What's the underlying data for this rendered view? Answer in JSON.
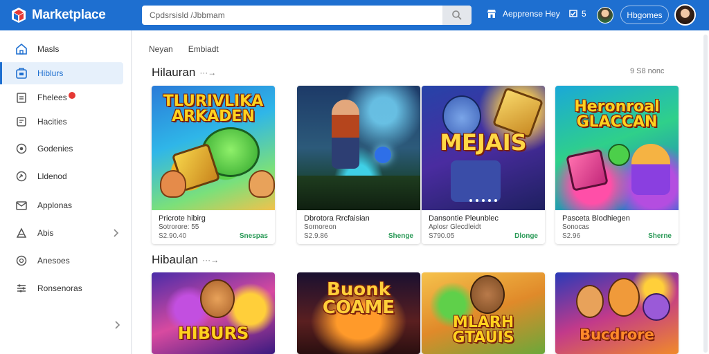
{
  "app": {
    "name": "Marketplace"
  },
  "search": {
    "placeholder": "Cpdsrsisld /Jbbmam"
  },
  "topbar": {
    "store_label": "Aepprense Hey",
    "cart_count": "5",
    "account_button": "Hbgomes"
  },
  "sidebar": {
    "items": [
      {
        "label": "Masls",
        "icon": "home-icon"
      },
      {
        "label": "Hiblurs",
        "icon": "store-icon",
        "active": true
      },
      {
        "label": "Fhelees",
        "icon": "bag-icon",
        "badge": true
      },
      {
        "label": "Hacities",
        "icon": "list-icon"
      },
      {
        "label": "Godenies",
        "icon": "gear-icon"
      },
      {
        "label": "Lldenod",
        "icon": "refresh-icon"
      },
      {
        "label": "Applonas",
        "icon": "mail-icon"
      },
      {
        "label": "Abis",
        "icon": "apps-icon",
        "chevron": true
      },
      {
        "label": "Anesoes",
        "icon": "help-icon"
      },
      {
        "label": "Ronsenoras",
        "icon": "settings-icon"
      }
    ]
  },
  "subtabs": [
    "Neyan",
    "Embiadt"
  ],
  "sections": [
    {
      "title": "Hilauran",
      "sort": "9 S8 nonc",
      "cards": [
        {
          "art": "TLURIVLIKA\nARKADEN",
          "title": "Pricrote hibirg",
          "sub": "Sotrorore: 55",
          "price": "S2.90.40",
          "action": "Snespas"
        },
        {
          "art": "",
          "title": "Dbrotora Rrcfaisian",
          "sub": "Sornoreon",
          "price": "S2.9.86",
          "action": "Shenge"
        },
        {
          "art": "MEJAIS",
          "title": "Dansontie Pleunblec",
          "sub": "Aplosr Glecdleidt",
          "price": "S790.05",
          "action": "Dlonge"
        },
        {
          "art": "Heronroal\nGLACCAN",
          "title": "Pasceta Blodhiegen",
          "sub": "Sonocas",
          "price": "S2.96",
          "action": "Sherne"
        }
      ]
    },
    {
      "title": "Hibaulan",
      "cards": [
        {
          "art": "HIBURS"
        },
        {
          "art": "Buonk\nCOAME"
        },
        {
          "art": "MLARH\nGTAUIS"
        },
        {
          "art": "Bucdrore"
        }
      ]
    }
  ],
  "colors": {
    "brand": "#1e6fd0",
    "action_green": "#2a9a57"
  }
}
